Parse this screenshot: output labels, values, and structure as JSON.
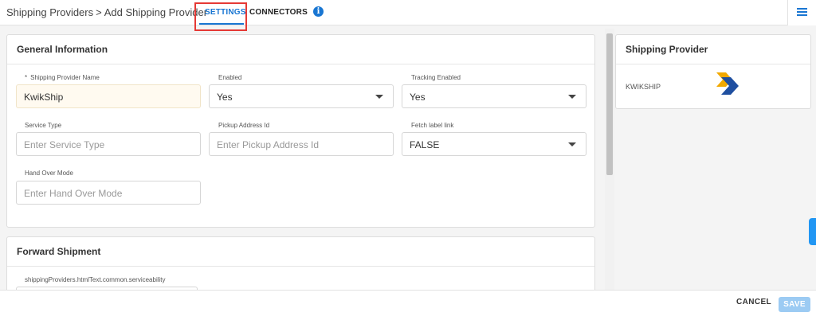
{
  "breadcrumb": {
    "parent": "Shipping Providers",
    "separator": ">",
    "current": "Add Shipping Provider"
  },
  "tabs": [
    {
      "label": "SETTINGS",
      "active": true
    },
    {
      "label": "CONNECTORS",
      "active": false
    }
  ],
  "header": {
    "info_glyph": "i"
  },
  "general": {
    "title": "General Information",
    "fields": {
      "provider_name": {
        "label": "Shipping Provider Name",
        "required_mark": "*",
        "value": "KwikShip"
      },
      "enabled": {
        "label": "Enabled",
        "value": "Yes"
      },
      "tracking_enabled": {
        "label": "Tracking Enabled",
        "value": "Yes"
      },
      "service_type": {
        "label": "Service Type",
        "placeholder": "Enter Service Type"
      },
      "pickup_address_id": {
        "label": "Pickup Address Id",
        "placeholder": "Enter Pickup Address Id"
      },
      "fetch_label_link": {
        "label": "Fetch label link",
        "value": "FALSE"
      },
      "hand_over_mode": {
        "label": "Hand Over Mode",
        "placeholder": "Enter Hand Over Mode"
      }
    }
  },
  "forward": {
    "title": "Forward Shipment",
    "serviceability_label": "shippingProviders.htmlText.common.serviceability"
  },
  "provider_card": {
    "title": "Shipping Provider",
    "name": "KWIKSHIP",
    "logo_colors": [
      "#f2a900",
      "#1f4fa0"
    ]
  },
  "footer": {
    "cancel_label": "CANCEL",
    "save_label": "SAVE"
  },
  "colors": {
    "accent": "#1976d2",
    "highlight": "#e53935"
  }
}
